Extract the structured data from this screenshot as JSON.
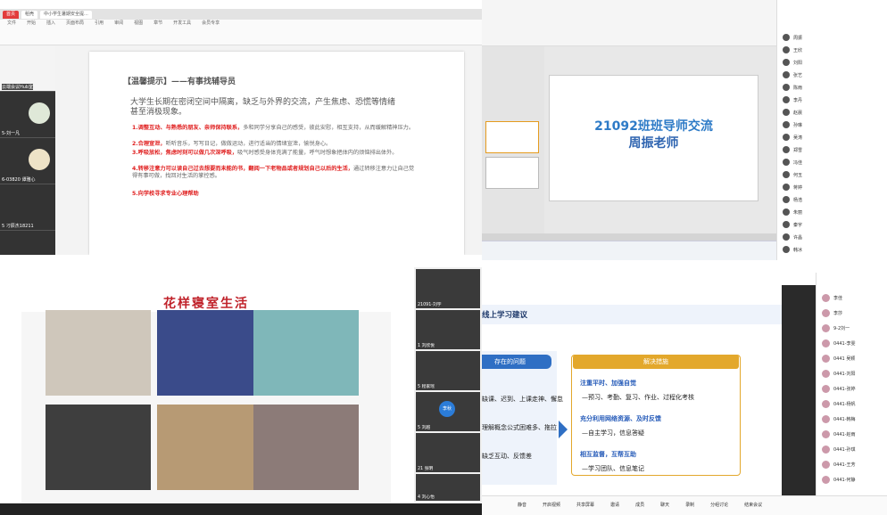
{
  "q1": {
    "tabs": [
      "首页",
      "稻壳",
      "中小学生暑期安全提..."
    ],
    "menus": [
      "文件",
      "开始",
      "插入",
      "页面布局",
      "引用",
      "审阅",
      "视图",
      "章节",
      "开发工具",
      "会员专享"
    ],
    "thumb_labels": [
      "云端会议Hub室",
      "5-刘一凡",
      "6-03820 谭雅心",
      "5 刁辰杰18211"
    ],
    "doc_title": "【温馨提示】——有事找辅导员",
    "doc_intro": "大学生长期在密闭空间中隔离，缺乏与外界的交流，产生焦虑、恐慌等情绪甚至消极现象。",
    "items": [
      {
        "lead": "1.调整互动、与熟悉的朋友、亲师保持联系，",
        "rest": "多和同学分享自己的感受，彼此安慰，相互支持，从而缓解精神压力。"
      },
      {
        "lead": "2.合理宣泄，",
        "rest": "听听音乐，写写日记，做做运动，进行适当的情绪宣泄，愉悦身心。"
      },
      {
        "lead": "3.呼吸放松，焦虑时刻可以做几次深呼吸，",
        "rest": "吸气时感受身体充满了能量，呼气时想象把体内的烦恼排出体外。"
      },
      {
        "lead": "4.转移注意力可以读自己过去想要而未能的书，翻阅一下老物品或者规划自己以后的生活，",
        "rest": "通过转移注意力让自己觉得有事可做，找回对生活的掌控感。"
      },
      {
        "lead": "5.向学校寻求专业心理帮助",
        "rest": ""
      }
    ]
  },
  "q2": {
    "slide_title_line1": "21092班班导师交流",
    "slide_title_line2": "周振老师"
  },
  "q3": {
    "participants": [
      "周振",
      "王欣",
      "刘阳",
      "张艺",
      "陈雨",
      "李丹",
      "赵晨",
      "孙琳",
      "吴涛",
      "郑雪",
      "冯佳",
      "何玉",
      "蒋婷",
      "杨浩",
      "朱丽",
      "秦宇",
      "许晶",
      "韩冰"
    ]
  },
  "q4": {
    "slide_title": "花样寝室生活",
    "side_names": [
      "21091-刘宇",
      "1 刘欣悦",
      "5 程家瑶",
      "5 刘越",
      "21 张明",
      "4 刘心怡"
    ],
    "center_badge": "李秋"
  },
  "q5": {
    "title": "线上学习建议",
    "left_header": "存在的问题",
    "right_header": "解决措施",
    "left_lines": [
      "缺课、迟到、上课走神、懈怠",
      "理解概念公式困难多、拖拉",
      "缺乏互动、反馈差"
    ],
    "right_items": [
      {
        "head": "注重平时、加强自觉",
        "body": "—预习、考勤、复习、作业、过程化考核"
      },
      {
        "head": "充分利用网络资源、及时反馈",
        "body": "—自主学习，信息答疑"
      },
      {
        "head": "相互监督，互帮互助",
        "body": "—学习团队、信息笔记"
      }
    ],
    "list_names": [
      "李佳",
      "李莎",
      "9-2刘一",
      "0441-李雯",
      "0441 吴颖",
      "0441-刘阳",
      "0441-张婷",
      "0441-杨帆",
      "0441-韩梅",
      "0441-赵雨",
      "0441-孙琪",
      "0441-王芳",
      "0441-何静"
    ],
    "controls": [
      "静音",
      "开启视频",
      "共享屏幕",
      "邀请",
      "成员",
      "聊天",
      "录制",
      "分组讨论",
      "结束会议"
    ]
  }
}
